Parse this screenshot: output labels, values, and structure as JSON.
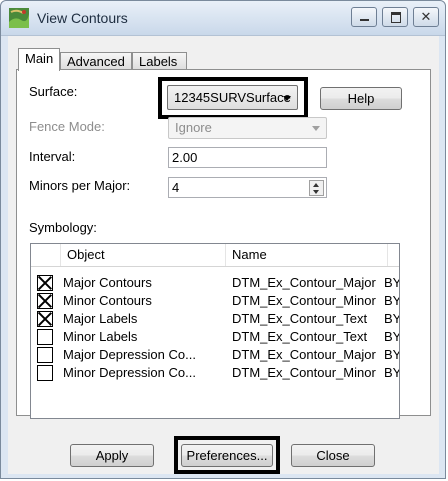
{
  "window": {
    "title": "View Contours"
  },
  "tabs": [
    {
      "label": "Main",
      "active": true
    },
    {
      "label": "Advanced",
      "active": false
    },
    {
      "label": "Labels",
      "active": false
    }
  ],
  "main": {
    "surface_label": "Surface:",
    "surface_value": "12345SURVSurface",
    "help_button": "Help",
    "fence_mode_label": "Fence Mode:",
    "fence_mode_value": "Ignore",
    "interval_label": "Interval:",
    "interval_value": "2.00",
    "minors_label": "Minors per Major:",
    "minors_value": "4",
    "symbology_label": "Symbology:"
  },
  "symbology": {
    "headers": [
      "Object",
      "Name"
    ],
    "rows": [
      {
        "checked": true,
        "object": "Major Contours",
        "name": "DTM_Ex_Contour_Major",
        "extra": "BYL"
      },
      {
        "checked": true,
        "object": "Minor Contours",
        "name": "DTM_Ex_Contour_Minor",
        "extra": "BYL"
      },
      {
        "checked": true,
        "object": "Major Labels",
        "name": "DTM_Ex_Contour_Text",
        "extra": "BYL"
      },
      {
        "checked": false,
        "object": "Minor Labels",
        "name": "DTM_Ex_Contour_Text",
        "extra": "BYL"
      },
      {
        "checked": false,
        "object": "Major Depression Co...",
        "name": "DTM_Ex_Contour_Major",
        "extra": "BYL"
      },
      {
        "checked": false,
        "object": "Minor Depression Co...",
        "name": "DTM_Ex_Contour_Minor",
        "extra": "BYL"
      }
    ]
  },
  "buttons": {
    "apply": "Apply",
    "preferences": "Preferences...",
    "close": "Close"
  },
  "caption_buttons": {
    "close_glyph": "✕"
  },
  "icons": {
    "app": "contour-map-icon",
    "minimize": "minimize-icon",
    "maximize": "maximize-icon",
    "close": "close-icon",
    "combo_arrow": "chevron-down-icon",
    "spin": "spinner-arrows-icon"
  },
  "colors": {
    "highlight_border": "#000000",
    "window_frame": "#dce6f2",
    "dialog_bg": "#f0f0f0"
  }
}
